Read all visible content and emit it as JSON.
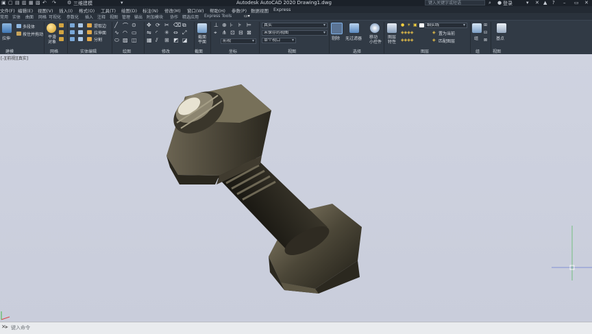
{
  "titlebar": {
    "workspace": "三维建模",
    "title": "Autodesk AutoCAD 2020    Drawing1.dwg",
    "search_placeholder": "键入关键字或短语",
    "login": "登录"
  },
  "menu": [
    "文件(F)",
    "编辑(E)",
    "视图(V)",
    "插入(I)",
    "格式(O)",
    "工具(T)",
    "绘图(D)",
    "标注(N)",
    "修改(M)",
    "窗口(W)",
    "帮助(H)",
    "参数(P)",
    "数据视图",
    "Express"
  ],
  "tabs": [
    "常用",
    "实体",
    "曲面",
    "网格",
    "可视化",
    "参数化",
    "插入",
    "注释",
    "视图",
    "管理",
    "输出",
    "附加模块",
    "协作",
    "精选应用",
    "Express Tools"
  ],
  "ribbon": {
    "modeling": {
      "label": "建模",
      "btn_extrude": "拉伸",
      "btn_polysolid": "多段体",
      "btn_presspull": "按住并拖动"
    },
    "mesh": {
      "label": "网格",
      "btn_smooth": "平滑\n对象"
    },
    "solid_edit": {
      "label": "实体编辑",
      "btn_extract": "提取边",
      "btn_extrude_face": "拉伸面",
      "btn_separate": "分割"
    },
    "draw": {
      "label": "绘图"
    },
    "modify": {
      "label": "修改"
    },
    "section": {
      "label": "截面",
      "btn_section_plane": "截面\n平面"
    },
    "coordinates": {
      "label": "坐标",
      "view_combo": "前视"
    },
    "view": {
      "label": "视图",
      "visual_style": "真实",
      "saved_view": "未保存的视图",
      "viewports": "单个视口"
    },
    "selection": {
      "label": "选择",
      "btn_cull": "剔除",
      "btn_no_filter": "无过滤器",
      "btn_gizmo": "移动\n小控件"
    },
    "layers": {
      "label": "图层",
      "btn_layer_props": "图层\n特性",
      "layer_combo": "细实线",
      "btn_set_current": "置为当前",
      "btn_match_layer": "匹配图层"
    },
    "groups": {
      "label": "组",
      "btn_group": "组"
    },
    "view2": {
      "label": "视图",
      "btn_base": "基点"
    }
  },
  "viewport": {
    "label": "[-][前视][真实]"
  },
  "command": {
    "placeholder": "键入命令"
  },
  "colors": {
    "viewport_bg": "#cfd3e0",
    "ribbon_bg": "#313a45",
    "bolt_dark": "#2e2b22",
    "bolt_light": "#7d7563"
  }
}
